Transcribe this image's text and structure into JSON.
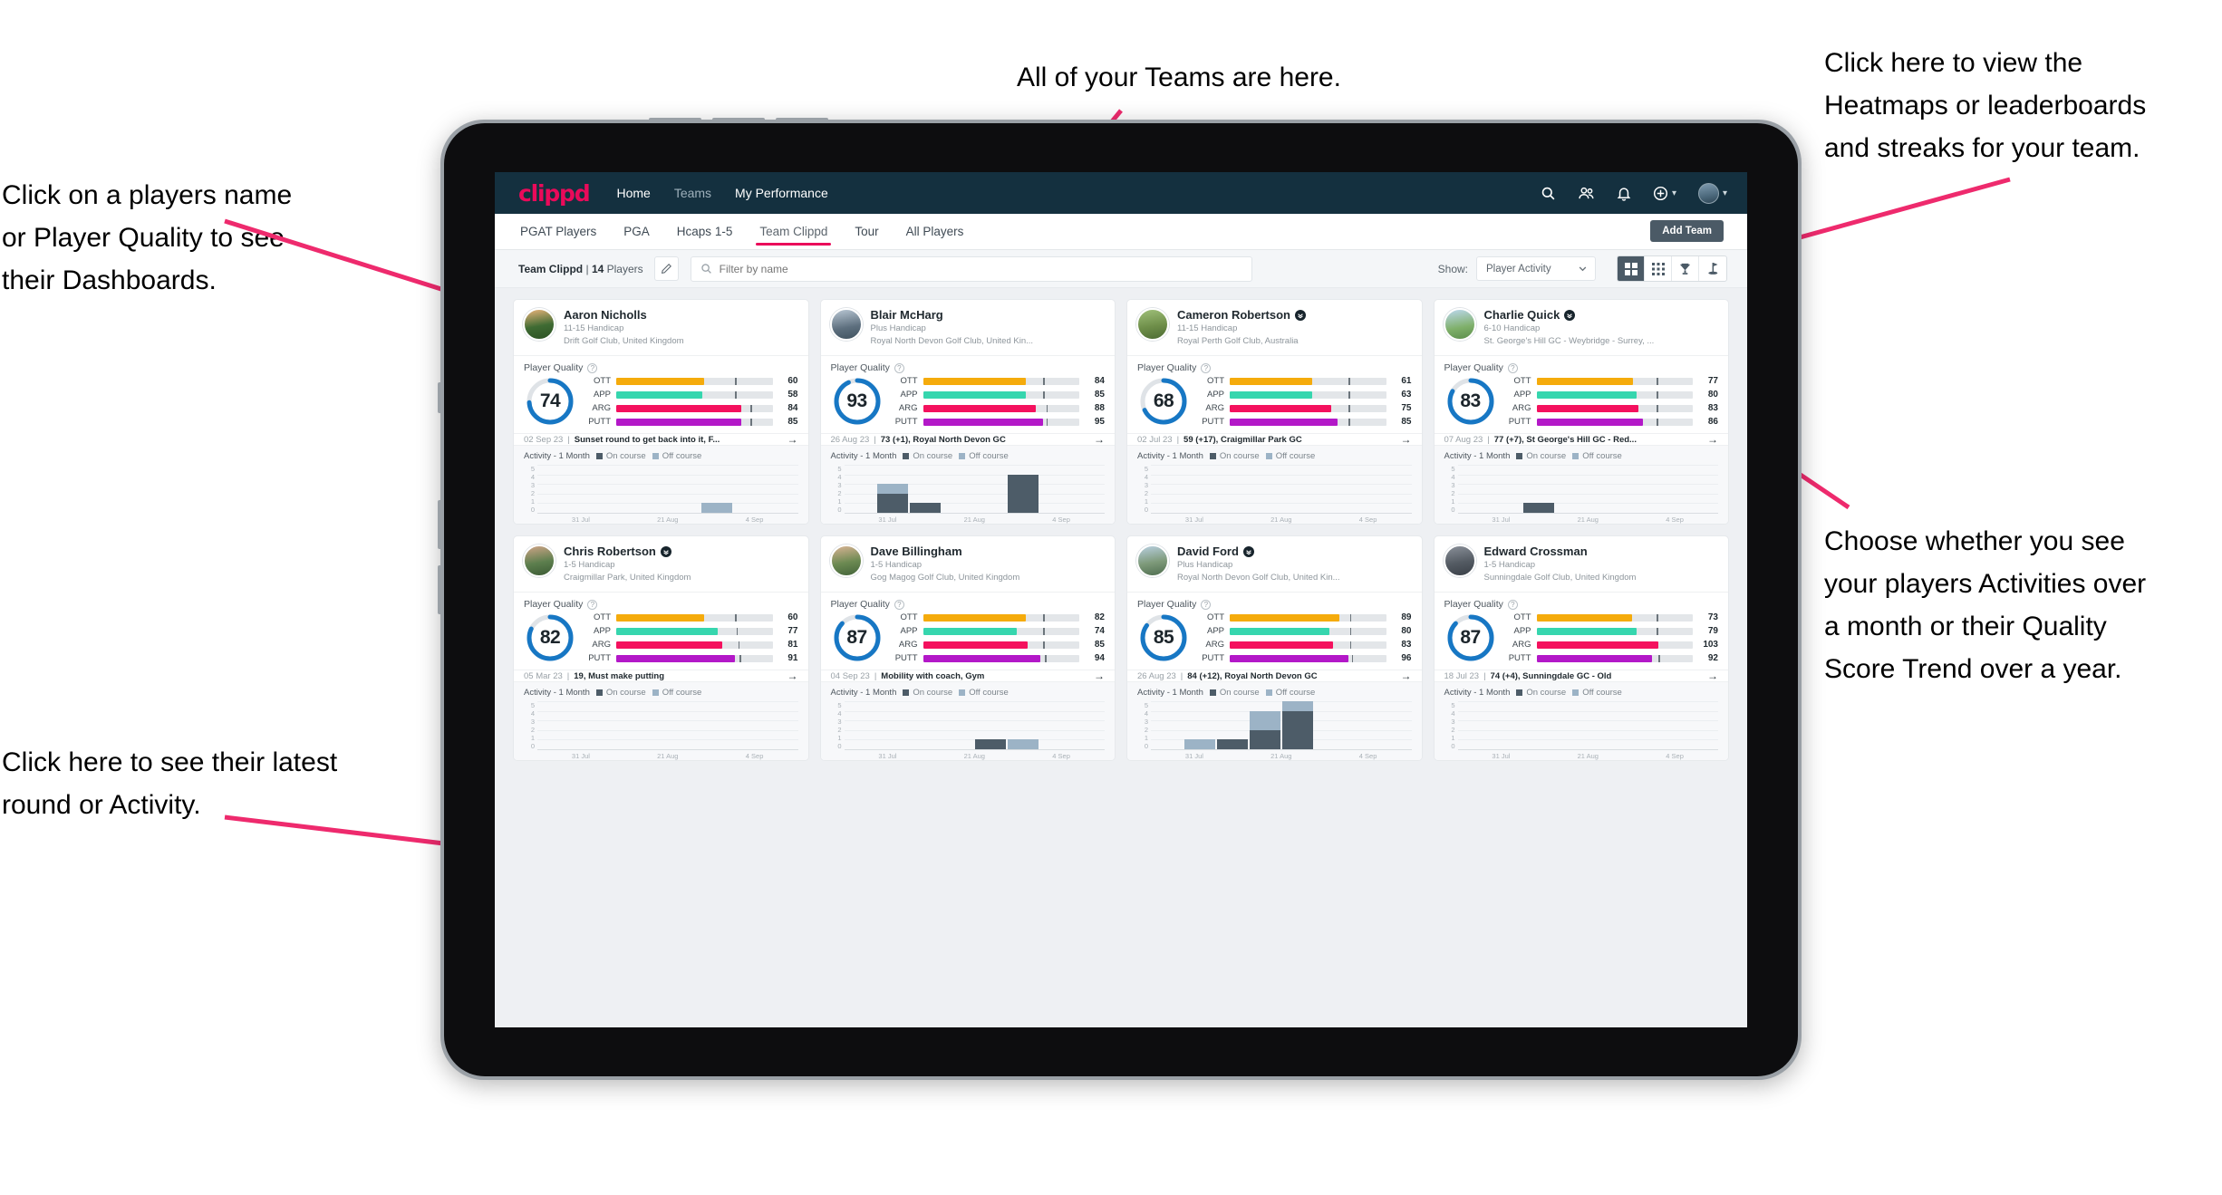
{
  "annotations": {
    "top_left": "Click on a players name\nor Player Quality to see\ntheir Dashboards.",
    "bottom_left": "Click here to see their latest\nround or Activity.",
    "top_center": "All of your Teams are here.",
    "top_right": "Click here to view the\nHeatmaps or leaderboards\nand streaks for your team.",
    "middle_right": "Choose whether you see\nyour players Activities over\na month or their Quality\nScore Trend over a year.",
    "arrow_color": "#ee2a6d"
  },
  "topnav": {
    "brand": "clippd",
    "links": [
      {
        "label": "Home",
        "active": true
      },
      {
        "label": "Teams",
        "active": false
      },
      {
        "label": "My Performance",
        "active": true
      }
    ],
    "icons": [
      "search-icon",
      "people-icon",
      "bell-icon",
      "plus-circle-icon",
      "avatar"
    ]
  },
  "tabs": {
    "items": [
      {
        "label": "PGAT Players",
        "active": false
      },
      {
        "label": "PGA",
        "active": false
      },
      {
        "label": "Hcaps 1-5",
        "active": false
      },
      {
        "label": "Team Clippd",
        "active": true
      },
      {
        "label": "Tour",
        "active": false
      },
      {
        "label": "All Players",
        "active": false
      }
    ],
    "add_team_label": "Add Team"
  },
  "toolbar": {
    "team_name": "Team Clippd",
    "team_count": "14",
    "players_word": "Players",
    "separator": "|",
    "search_placeholder": "Filter by name",
    "search_value": "",
    "show_label": "Show:",
    "show_value": "Player Activity",
    "show_options": [
      "Player Activity",
      "Quality Score Trend"
    ],
    "views": [
      {
        "name": "grid-view-icon",
        "active": true
      },
      {
        "name": "dense-grid-view-icon",
        "active": false
      },
      {
        "name": "trophy-view-icon",
        "active": false
      },
      {
        "name": "flag-view-icon",
        "active": false
      }
    ]
  },
  "card_labels": {
    "player_quality": "Player Quality",
    "activity": "Activity - 1 Month",
    "legend_on": "On course",
    "legend_off": "Off course",
    "axis_x": [
      "31 Jul",
      "21 Aug",
      "4 Sep"
    ],
    "axis_y": [
      "5",
      "4",
      "3",
      "2",
      "1",
      "0"
    ]
  },
  "colors": {
    "brand_pink": "#ea0a5a",
    "nav_dark": "#14303f",
    "ring_blue": "#1777c4",
    "ott": "#f5ab0c",
    "app": "#36d6ae",
    "arg": "#f4115e",
    "putt": "#b318c8",
    "on_course": "#4d5c68",
    "off_course": "#9cb3c6"
  },
  "players": [
    {
      "name": "Aaron Nicholls",
      "verified": false,
      "handicap": "11-15 Handicap",
      "club": "Drift Golf Club, United Kingdom",
      "quality": 74,
      "metrics": [
        {
          "label": "OTT",
          "value": 60,
          "fill": 56,
          "tick": 76
        },
        {
          "label": "APP",
          "value": 58,
          "fill": 55,
          "tick": 76
        },
        {
          "label": "ARG",
          "value": 84,
          "fill": 80,
          "tick": 86
        },
        {
          "label": "PUTT",
          "value": 85,
          "fill": 80,
          "tick": 86
        }
      ],
      "latest_date": "02 Sep 23",
      "latest_text": "Sunset round to get back into it, F...",
      "chart_data": {
        "type": "bar",
        "stacked": true,
        "categories": [
          "31 Jul",
          "",
          "",
          "",
          "",
          "21 Aug",
          "",
          "4 Sep"
        ],
        "series": [
          {
            "name": "On course",
            "values": [
              0,
              0,
              0,
              0,
              0,
              0,
              0,
              0
            ]
          },
          {
            "name": "Off course",
            "values": [
              0,
              0,
              0,
              0,
              0,
              1,
              0,
              0
            ]
          }
        ],
        "ylim": [
          0,
          5
        ],
        "ylabel": "",
        "xlabel": "",
        "grid": true
      }
    },
    {
      "name": "Blair McHarg",
      "verified": false,
      "handicap": "Plus Handicap",
      "club": "Royal North Devon Golf Club, United Kin...",
      "quality": 93,
      "metrics": [
        {
          "label": "OTT",
          "value": 84,
          "fill": 66,
          "tick": 77
        },
        {
          "label": "APP",
          "value": 85,
          "fill": 66,
          "tick": 77
        },
        {
          "label": "ARG",
          "value": 88,
          "fill": 72,
          "tick": 79
        },
        {
          "label": "PUTT",
          "value": 95,
          "fill": 77,
          "tick": 79
        }
      ],
      "latest_date": "26 Aug 23",
      "latest_text": "73 (+1), Royal North Devon GC",
      "chart_data": {
        "type": "bar",
        "stacked": true,
        "categories": [
          "31 Jul",
          "",
          "",
          "",
          "",
          "21 Aug",
          "",
          "4 Sep"
        ],
        "series": [
          {
            "name": "On course",
            "values": [
              0,
              2,
              1,
              0,
              0,
              4,
              0,
              0
            ]
          },
          {
            "name": "Off course",
            "values": [
              0,
              1,
              0,
              0,
              0,
              0,
              0,
              0
            ]
          }
        ],
        "ylim": [
          0,
          5
        ],
        "ylabel": "",
        "xlabel": "",
        "grid": true
      }
    },
    {
      "name": "Cameron Robertson",
      "verified": true,
      "handicap": "11-15 Handicap",
      "club": "Royal Perth Golf Club, Australia",
      "quality": 68,
      "metrics": [
        {
          "label": "OTT",
          "value": 61,
          "fill": 53,
          "tick": 76
        },
        {
          "label": "APP",
          "value": 63,
          "fill": 53,
          "tick": 76
        },
        {
          "label": "ARG",
          "value": 75,
          "fill": 65,
          "tick": 76
        },
        {
          "label": "PUTT",
          "value": 85,
          "fill": 69,
          "tick": 76
        }
      ],
      "latest_date": "02 Jul 23",
      "latest_text": "59 (+17), Craigmillar Park GC",
      "chart_data": {
        "type": "bar",
        "stacked": true,
        "categories": [
          "31 Jul",
          "",
          "",
          "",
          "",
          "21 Aug",
          "",
          "4 Sep"
        ],
        "series": [
          {
            "name": "On course",
            "values": [
              0,
              0,
              0,
              0,
              0,
              0,
              0,
              0
            ]
          },
          {
            "name": "Off course",
            "values": [
              0,
              0,
              0,
              0,
              0,
              0,
              0,
              0
            ]
          }
        ],
        "ylim": [
          0,
          5
        ],
        "ylabel": "",
        "xlabel": "",
        "grid": true
      }
    },
    {
      "name": "Charlie Quick",
      "verified": true,
      "handicap": "6-10 Handicap",
      "club": "St. George's Hill GC - Weybridge - Surrey, ...",
      "quality": 83,
      "metrics": [
        {
          "label": "OTT",
          "value": 77,
          "fill": 62,
          "tick": 77
        },
        {
          "label": "APP",
          "value": 80,
          "fill": 64,
          "tick": 77
        },
        {
          "label": "ARG",
          "value": 83,
          "fill": 65,
          "tick": 77
        },
        {
          "label": "PUTT",
          "value": 86,
          "fill": 68,
          "tick": 77
        }
      ],
      "latest_date": "07 Aug 23",
      "latest_text": "77 (+7), St George's Hill GC - Red...",
      "chart_data": {
        "type": "bar",
        "stacked": true,
        "categories": [
          "31 Jul",
          "",
          "",
          "",
          "",
          "21 Aug",
          "",
          "4 Sep"
        ],
        "series": [
          {
            "name": "On course",
            "values": [
              0,
              0,
              1,
              0,
              0,
              0,
              0,
              0
            ]
          },
          {
            "name": "Off course",
            "values": [
              0,
              0,
              0,
              0,
              0,
              0,
              0,
              0
            ]
          }
        ],
        "ylim": [
          0,
          5
        ],
        "ylabel": "",
        "xlabel": "",
        "grid": true
      }
    },
    {
      "name": "Chris Robertson",
      "verified": true,
      "handicap": "1-5 Handicap",
      "club": "Craigmillar Park, United Kingdom",
      "quality": 82,
      "metrics": [
        {
          "label": "OTT",
          "value": 60,
          "fill": 56,
          "tick": 76
        },
        {
          "label": "APP",
          "value": 77,
          "fill": 65,
          "tick": 77
        },
        {
          "label": "ARG",
          "value": 81,
          "fill": 68,
          "tick": 78
        },
        {
          "label": "PUTT",
          "value": 91,
          "fill": 76,
          "tick": 79
        }
      ],
      "latest_date": "05 Mar 23",
      "latest_text": "19, Must make putting",
      "chart_data": {
        "type": "bar",
        "stacked": true,
        "categories": [
          "31 Jul",
          "",
          "",
          "",
          "",
          "21 Aug",
          "",
          "4 Sep"
        ],
        "series": [
          {
            "name": "On course",
            "values": [
              0,
              0,
              0,
              0,
              0,
              0,
              0,
              0
            ]
          },
          {
            "name": "Off course",
            "values": [
              0,
              0,
              0,
              0,
              0,
              0,
              0,
              0
            ]
          }
        ],
        "ylim": [
          0,
          5
        ],
        "ylabel": "",
        "xlabel": "",
        "grid": true
      }
    },
    {
      "name": "Dave Billingham",
      "verified": false,
      "handicap": "1-5 Handicap",
      "club": "Gog Magog Golf Club, United Kingdom",
      "quality": 87,
      "metrics": [
        {
          "label": "OTT",
          "value": 82,
          "fill": 66,
          "tick": 77
        },
        {
          "label": "APP",
          "value": 74,
          "fill": 60,
          "tick": 77
        },
        {
          "label": "ARG",
          "value": 85,
          "fill": 67,
          "tick": 77
        },
        {
          "label": "PUTT",
          "value": 94,
          "fill": 75,
          "tick": 78
        }
      ],
      "latest_date": "04 Sep 23",
      "latest_text": "Mobility with coach, Gym",
      "chart_data": {
        "type": "bar",
        "stacked": true,
        "categories": [
          "31 Jul",
          "",
          "",
          "",
          "",
          "21 Aug",
          "",
          "4 Sep"
        ],
        "series": [
          {
            "name": "On course",
            "values": [
              0,
              0,
              0,
              0,
              1,
              0,
              0,
              0
            ]
          },
          {
            "name": "Off course",
            "values": [
              0,
              0,
              0,
              0,
              0,
              1,
              0,
              0
            ]
          }
        ],
        "ylim": [
          0,
          5
        ],
        "ylabel": "",
        "xlabel": "",
        "grid": true
      }
    },
    {
      "name": "David Ford",
      "verified": true,
      "handicap": "Plus Handicap",
      "club": "Royal North Devon Golf Club, United Kin...",
      "quality": 85,
      "metrics": [
        {
          "label": "OTT",
          "value": 89,
          "fill": 70,
          "tick": 77
        },
        {
          "label": "APP",
          "value": 80,
          "fill": 64,
          "tick": 77
        },
        {
          "label": "ARG",
          "value": 83,
          "fill": 66,
          "tick": 77
        },
        {
          "label": "PUTT",
          "value": 96,
          "fill": 76,
          "tick": 78
        }
      ],
      "latest_date": "26 Aug 23",
      "latest_text": "84 (+12), Royal North Devon GC",
      "chart_data": {
        "type": "bar",
        "stacked": true,
        "categories": [
          "31 Jul",
          "",
          "",
          "",
          "",
          "21 Aug",
          "",
          "4 Sep"
        ],
        "series": [
          {
            "name": "On course",
            "values": [
              0,
              0,
              1,
              2,
              4,
              0,
              0,
              0
            ]
          },
          {
            "name": "Off course",
            "values": [
              0,
              1,
              0,
              2,
              1,
              0,
              0,
              0
            ]
          }
        ],
        "ylim": [
          0,
          5
        ],
        "ylabel": "",
        "xlabel": "",
        "grid": true
      }
    },
    {
      "name": "Edward Crossman",
      "verified": false,
      "handicap": "1-5 Handicap",
      "club": "Sunningdale Golf Club, United Kingdom",
      "quality": 87,
      "metrics": [
        {
          "label": "OTT",
          "value": 73,
          "fill": 61,
          "tick": 77
        },
        {
          "label": "APP",
          "value": 79,
          "fill": 64,
          "tick": 77
        },
        {
          "label": "ARG",
          "value": 103,
          "fill": 78,
          "tick": 0
        },
        {
          "label": "PUTT",
          "value": 92,
          "fill": 74,
          "tick": 78
        }
      ],
      "latest_date": "18 Jul 23",
      "latest_text": "74 (+4), Sunningdale GC - Old",
      "chart_data": {
        "type": "bar",
        "stacked": true,
        "categories": [
          "31 Jul",
          "",
          "",
          "",
          "",
          "21 Aug",
          "",
          "4 Sep"
        ],
        "series": [
          {
            "name": "On course",
            "values": [
              0,
              0,
              0,
              0,
              0,
              0,
              0,
              0
            ]
          },
          {
            "name": "Off course",
            "values": [
              0,
              0,
              0,
              0,
              0,
              0,
              0,
              0
            ]
          }
        ],
        "ylim": [
          0,
          5
        ],
        "ylabel": "",
        "xlabel": "",
        "grid": true
      }
    }
  ]
}
